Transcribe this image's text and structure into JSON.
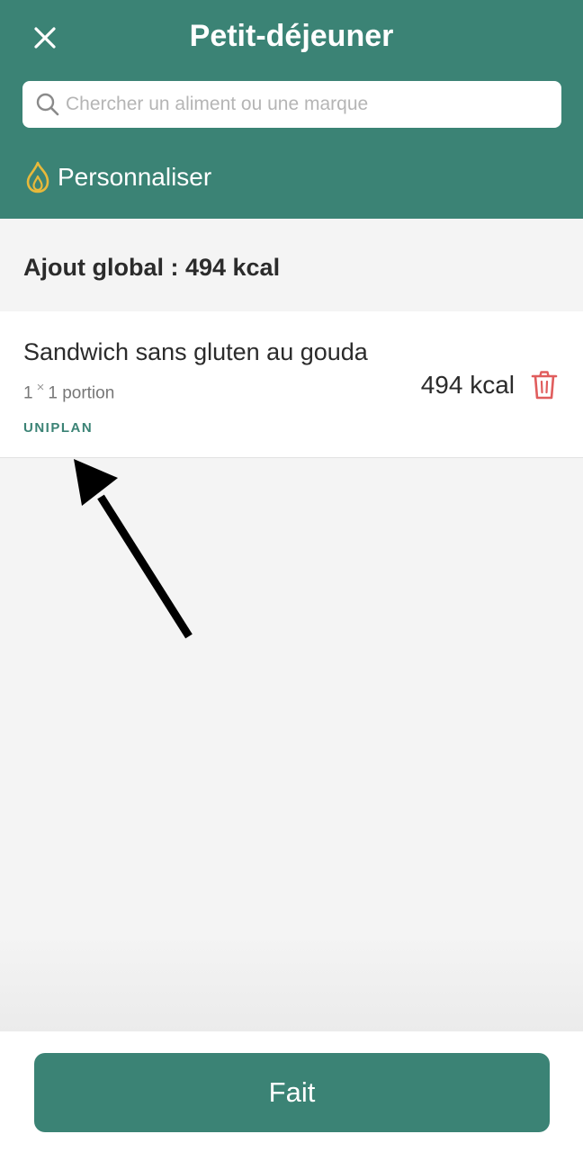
{
  "header": {
    "title": "Petit-déjeuner",
    "close_icon": "close-icon",
    "background_color": "#3b8375"
  },
  "search": {
    "placeholder": "Chercher un aliment ou une marque",
    "value": "",
    "icon": "search-icon"
  },
  "customize": {
    "label": "Personnaliser",
    "icon": "flame-icon",
    "icon_color": "#e8b93a"
  },
  "summary": {
    "text": "Ajout global : 494 kcal"
  },
  "food_items": [
    {
      "name": "Sandwich sans gluten au gouda",
      "quantity": "1",
      "multiplier": "×",
      "portion": "1 portion",
      "brand": "UNIPLAN",
      "kcal": "494 kcal",
      "delete_icon": "trash-icon",
      "delete_color": "#e05d5d"
    }
  ],
  "annotation": {
    "icon": "arrow-icon",
    "color": "#000000"
  },
  "footer": {
    "done_label": "Fait"
  }
}
